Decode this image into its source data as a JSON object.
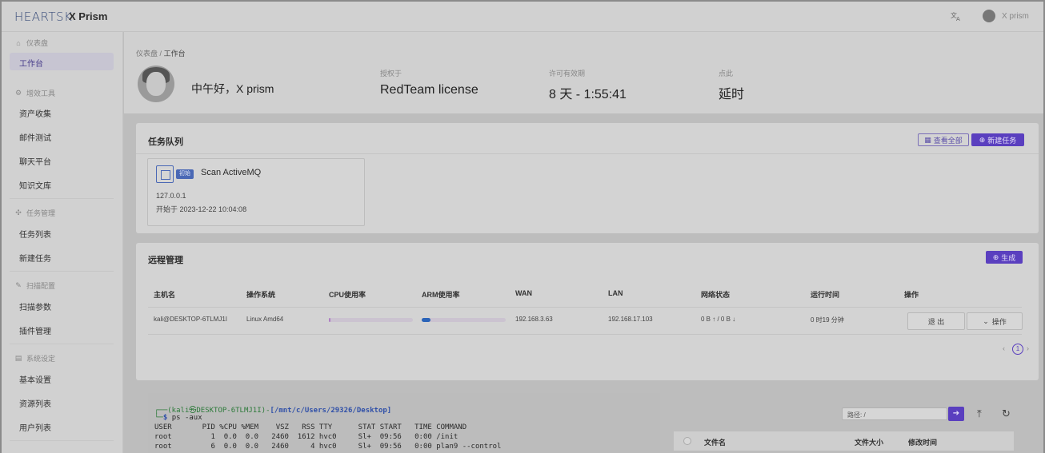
{
  "topbar": {
    "logo": "HEARTSK",
    "app_title": "X Prism",
    "translate_icon": "translate-icon",
    "user_name": "X prism"
  },
  "sidebar": {
    "groups": [
      {
        "label": "仪表盘",
        "icon": "home-icon"
      },
      {
        "label": "增效工具",
        "icon": "gear-icon"
      },
      {
        "label": "任务管理",
        "icon": "target-icon"
      },
      {
        "label": "扫描配置",
        "icon": "edit-icon"
      },
      {
        "label": "系统设定",
        "icon": "settings-icon"
      }
    ],
    "items": {
      "workbench": "工作台",
      "asset_collect": "资产收集",
      "mail_test": "邮件测试",
      "chat_platform": "聊天平台",
      "knowledge": "知识文库",
      "task_list": "任务列表",
      "new_task": "新建任务",
      "scan_params": "扫描参数",
      "plugin_mgmt": "插件管理",
      "basic_settings": "基本设置",
      "resource_list": "资源列表",
      "user_list": "用户列表"
    }
  },
  "header": {
    "breadcrumb_root": "仪表盘",
    "breadcrumb_sep": "/",
    "breadcrumb_current": "工作台",
    "greeting": "中午好，X prism",
    "license_label": "授权于",
    "license_value": "RedTeam license",
    "validity_label": "许可有效期",
    "validity_value": "8 天 - 1:55:41",
    "latency_label": "点此",
    "latency_value": "延时"
  },
  "task_queue": {
    "title": "任务队列",
    "view_all": "查看全部",
    "new_task": "新建任务",
    "task": {
      "badge": "初始",
      "name": "Scan ActiveMQ",
      "ip": "127.0.0.1",
      "started": "开始于 2023-12-22 10:04:08"
    }
  },
  "remote": {
    "title": "远程管理",
    "generate": "生成",
    "columns": [
      "主机名",
      "操作系统",
      "CPU使用率",
      "ARM使用率",
      "WAN",
      "LAN",
      "网络状态",
      "运行时间",
      "操作"
    ],
    "row": {
      "host": "kali@DESKTOP-6TLMJ1I",
      "os": "Linux Amd64",
      "cpu_pct": 1,
      "ram_pct": 10,
      "wan": "192.168.3.63",
      "lan": "192.168.17.103",
      "net": "0 B ↑ / 0 B ↓",
      "uptime": "0 时19 分钟",
      "exit_label": "退 出",
      "ops_label": "操作"
    },
    "page": "1"
  },
  "terminal": {
    "prompt_user": "(kali㉿DESKTOP-6TLMJ1I)",
    "prompt_path": "[/mnt/c/Users/29326/Desktop]",
    "command": "ps -aux",
    "header": "USER       PID %CPU %MEM    VSZ   RSS TTY      STAT START   TIME COMMAND",
    "line1": "root         1  0.0  0.0   2460  1612 hvc0     Sl+  09:56   0:00 /init",
    "line2": "root         6  0.0  0.0   2460     4 hvc0     Sl+  09:56   0:00 plan9 --control"
  },
  "files": {
    "path_label": "路径:",
    "path_value": "/",
    "col_name": "文件名",
    "col_size": "文件大小",
    "col_mtime": "修改时间"
  },
  "colors": {
    "accent": "#5a3fbf",
    "task_blue": "#4a68b5",
    "cpu_bar": "#b07fc4",
    "ram_bar": "#2a63b8"
  }
}
